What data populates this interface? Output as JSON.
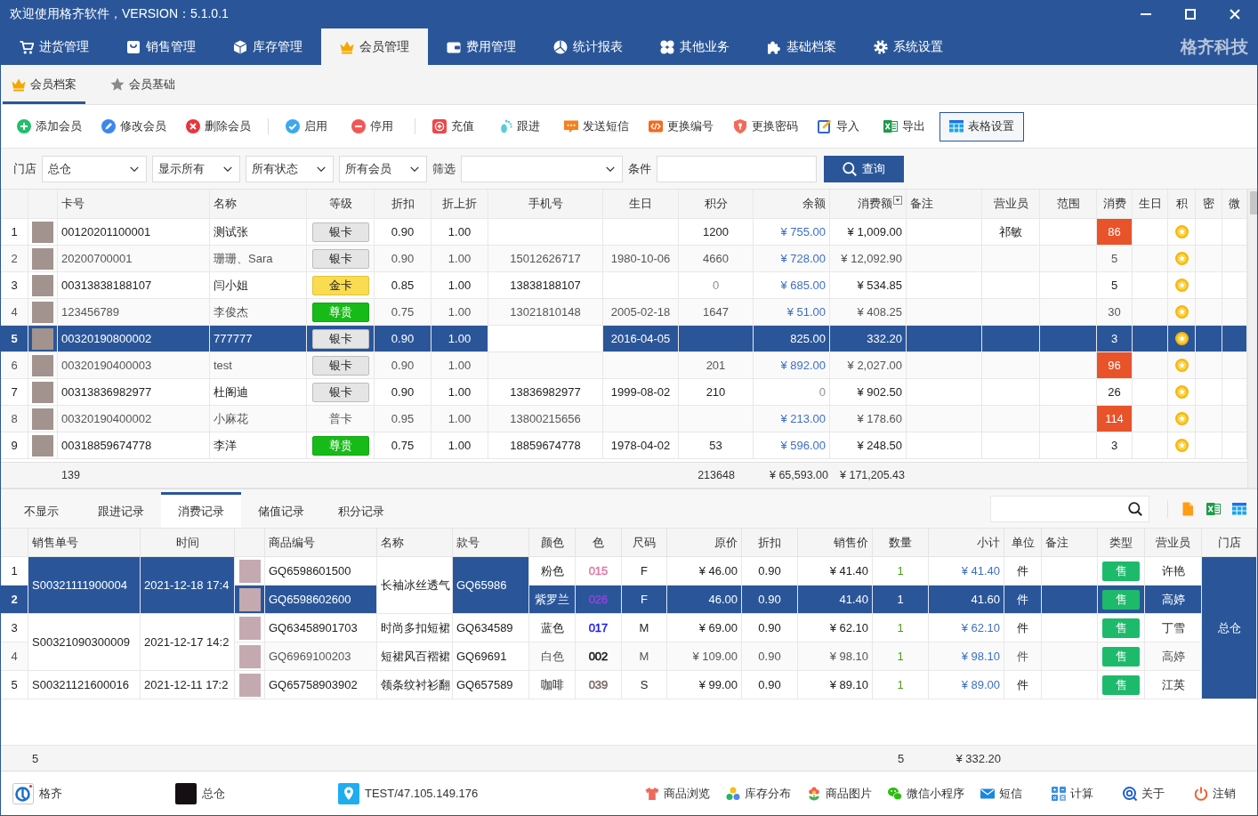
{
  "window": {
    "title": "欢迎使用格齐软件，VERSION：5.1.0.1",
    "brand": "格齐科技"
  },
  "nav_tabs": [
    {
      "label": "进货管理",
      "selected": false
    },
    {
      "label": "销售管理",
      "selected": false
    },
    {
      "label": "库存管理",
      "selected": false
    },
    {
      "label": "会员管理",
      "selected": true
    },
    {
      "label": "费用管理",
      "selected": false
    },
    {
      "label": "统计报表",
      "selected": false
    },
    {
      "label": "其他业务",
      "selected": false
    },
    {
      "label": "基础档案",
      "selected": false
    },
    {
      "label": "系统设置",
      "selected": false
    }
  ],
  "sub_tabs": [
    {
      "label": "会员档案",
      "selected": true
    },
    {
      "label": "会员基础",
      "selected": false
    }
  ],
  "toolbar": [
    [
      {
        "label": "添加会员",
        "active": false
      },
      {
        "label": "修改会员",
        "active": false
      },
      {
        "label": "删除会员",
        "active": false
      }
    ],
    [
      {
        "label": "启用",
        "active": false
      },
      {
        "label": "停用",
        "active": false
      }
    ],
    [
      {
        "label": "充值",
        "active": false
      },
      {
        "label": "跟进",
        "active": false
      },
      {
        "label": "发送短信",
        "active": false
      },
      {
        "label": "更换编号",
        "active": false
      },
      {
        "label": "更换密码",
        "active": false
      },
      {
        "label": "导入",
        "active": false
      },
      {
        "label": "导出",
        "active": false
      },
      {
        "label": "表格设置",
        "active": true
      }
    ]
  ],
  "filter": {
    "store_label": "门店",
    "selects": [
      {
        "value": "总仓"
      },
      {
        "value": "显示所有"
      },
      {
        "value": "所有状态"
      },
      {
        "value": "所有会员"
      }
    ],
    "filter_label": "筛选",
    "condition_label": "条件",
    "query_button": "查询"
  },
  "members": {
    "columns": [
      {
        "label": "卡号",
        "current": false
      },
      {
        "label": "名称",
        "current": false
      },
      {
        "label": "等级",
        "current": false
      },
      {
        "label": "折扣",
        "current": false
      },
      {
        "label": "折上折",
        "current": false
      },
      {
        "label": "手机号",
        "current": true
      },
      {
        "label": "生日",
        "current": false
      },
      {
        "label": "积分",
        "current": false
      },
      {
        "label": "余额",
        "current": false
      },
      {
        "label": "消费额",
        "current": false
      },
      {
        "label": "备注",
        "current": false
      },
      {
        "label": "营业员",
        "current": false
      },
      {
        "label": "范围",
        "current": false
      },
      {
        "label": "消费",
        "current": false
      },
      {
        "label": "生日",
        "current": false
      },
      {
        "label": "积",
        "current": false
      },
      {
        "label": "密",
        "current": false
      },
      {
        "label": "微",
        "current": false
      }
    ],
    "rows": [
      {
        "no": "1",
        "card": "00120201100001",
        "name": "测试张",
        "grade": {
          "text": "银卡",
          "kind": "silver"
        },
        "discount": "0.90",
        "discount2": "1.00",
        "points": "1200",
        "points_muted": false,
        "balance": "¥ 755.00",
        "balance_muted": false,
        "spent": "¥ 1,009.00",
        "clerk": "祁敏",
        "visits": "86",
        "hot": true,
        "selected": false
      },
      {
        "no": "2",
        "card": "20200700001",
        "name": "珊珊、Sara",
        "grade": {
          "text": "银卡",
          "kind": "silver"
        },
        "discount": "0.90",
        "discount2": "1.00",
        "phone": "15012626717",
        "birthday": "1980-10-06",
        "points": "4660",
        "points_muted": false,
        "balance": "¥ 728.00",
        "balance_muted": false,
        "spent": "¥ 12,092.90",
        "visits": "5",
        "hot": false,
        "selected": false
      },
      {
        "no": "3",
        "card": "00313838188107",
        "name": "闫小姐",
        "grade": {
          "text": "金卡",
          "kind": "gold"
        },
        "discount": "0.85",
        "discount2": "1.00",
        "phone": "13838188107",
        "points": "0",
        "points_muted": true,
        "balance": "¥ 685.00",
        "balance_muted": false,
        "spent": "¥ 534.85",
        "visits": "5",
        "hot": false,
        "selected": false
      },
      {
        "no": "4",
        "card": "123456789",
        "name": "李俊杰",
        "grade": {
          "text": "尊贵",
          "kind": "premium"
        },
        "discount": "0.75",
        "discount2": "1.00",
        "phone": "13021810148",
        "birthday": "2005-02-18",
        "points": "1647",
        "points_muted": false,
        "balance": "¥ 51.00",
        "balance_muted": false,
        "spent": "¥ 408.25",
        "visits": "30",
        "hot": false,
        "selected": false
      },
      {
        "no": "5",
        "card": "00320190800002",
        "name": "777777",
        "grade": {
          "text": "银卡",
          "kind": "silver"
        },
        "discount": "0.90",
        "discount2": "1.00",
        "birthday": "2016-04-05",
        "balance": "825.00",
        "balance_muted": false,
        "spent": "332.20",
        "visits": "3",
        "hot": false,
        "selected": true
      },
      {
        "no": "6",
        "card": "00320190400003",
        "name": "test",
        "grade": {
          "text": "银卡",
          "kind": "silver"
        },
        "discount": "0.90",
        "discount2": "1.00",
        "points": "201",
        "points_muted": false,
        "balance": "¥ 892.00",
        "balance_muted": false,
        "spent": "¥ 2,027.00",
        "visits": "96",
        "hot": true,
        "selected": false
      },
      {
        "no": "7",
        "card": "00313836982977",
        "name": "杜阁迪",
        "grade": {
          "text": "银卡",
          "kind": "silver"
        },
        "discount": "0.90",
        "discount2": "1.00",
        "phone": "13836982977",
        "birthday": "1999-08-02",
        "points": "210",
        "points_muted": false,
        "balance": "0",
        "balance_muted": true,
        "spent": "¥ 902.50",
        "visits": "26",
        "hot": false,
        "selected": false
      },
      {
        "no": "8",
        "card": "00320190400002",
        "name": "小麻花",
        "grade": {
          "text": "普卡",
          "kind": "plain"
        },
        "discount": "0.95",
        "discount2": "1.00",
        "phone": "13800215656",
        "balance": "¥ 213.00",
        "balance_muted": false,
        "spent": "¥ 178.60",
        "visits": "114",
        "hot": true,
        "selected": false
      },
      {
        "no": "9",
        "card": "00318859674778",
        "name": "李洋",
        "grade": {
          "text": "尊贵",
          "kind": "premium"
        },
        "discount": "0.75",
        "discount2": "1.00",
        "phone": "18859674778",
        "birthday": "1978-04-02",
        "points": "53",
        "points_muted": false,
        "balance": "¥ 596.00",
        "balance_muted": false,
        "spent": "¥ 248.50",
        "visits": "3",
        "hot": false,
        "selected": false
      }
    ],
    "totals": {
      "count": "139",
      "points": "213648",
      "balance": "¥ 65,593.00",
      "spent": "¥ 171,205.43"
    }
  },
  "record_tabs": [
    {
      "label": "不显示",
      "selected": false
    },
    {
      "label": "跟进记录",
      "selected": false
    },
    {
      "label": "消费记录",
      "selected": true
    },
    {
      "label": "储值记录",
      "selected": false
    },
    {
      "label": "积分记录",
      "selected": false
    }
  ],
  "consumption": {
    "columns": [
      {
        "label": "销售单号",
        "current": false
      },
      {
        "label": "时间",
        "current": false
      },
      {
        "label": "商品编号",
        "current": false
      },
      {
        "label": "名称",
        "current": true
      },
      {
        "label": "款号",
        "current": false
      },
      {
        "label": "颜色",
        "current": false
      },
      {
        "label": "色",
        "current": false
      },
      {
        "label": "尺码",
        "current": false
      },
      {
        "label": "原价",
        "current": false
      },
      {
        "label": "折扣",
        "current": false
      },
      {
        "label": "销售价",
        "current": false
      },
      {
        "label": "数量",
        "current": false
      },
      {
        "label": "小计",
        "current": false
      },
      {
        "label": "单位",
        "current": false
      },
      {
        "label": "备注",
        "current": false
      },
      {
        "label": "类型",
        "current": false
      },
      {
        "label": "营业员",
        "current": false
      },
      {
        "label": "门店",
        "current": false
      }
    ],
    "orders": [
      {
        "sale_no": "S00321111900004",
        "time": "2021-12-18 17:4",
        "styles": [
          {
            "name": "长袖冰丝透气",
            "style_no": "GQ65986",
            "items": [
              {
                "no": "1",
                "code": "GQ6598601500",
                "color_name": "粉色",
                "color_code": "015",
                "color": "#e27aa3",
                "size": "F",
                "price": "¥ 46.00",
                "discount": "0.90",
                "sale_price": "¥ 41.40",
                "qty": "1",
                "subtotal": "¥ 41.40",
                "unit": "件",
                "type": "售",
                "clerk": "许艳",
                "selected": false
              },
              {
                "no": "2",
                "code": "GQ6598602600",
                "color_name": "紫罗兰",
                "color_code": "026",
                "color": "#8e44d8",
                "size": "F",
                "price": "46.00",
                "discount": "0.90",
                "sale_price": "41.40",
                "qty": "1",
                "subtotal": "41.60",
                "unit": "件",
                "type": "售",
                "clerk": "高婷",
                "selected": true
              }
            ]
          }
        ]
      },
      {
        "sale_no": "S00321090300009",
        "time": "2021-12-17 14:2",
        "styles": [
          {
            "name": "时尚多扣短裙",
            "style_no": "GQ634589",
            "items": [
              {
                "no": "3",
                "code": "GQ63458901703",
                "color_name": "蓝色",
                "color_code": "017",
                "color": "#1c1cf0",
                "size": "M",
                "price": "¥ 69.00",
                "discount": "0.90",
                "sale_price": "¥ 62.10",
                "qty": "1",
                "subtotal": "¥ 62.10",
                "unit": "件",
                "type": "售",
                "clerk": "丁雪",
                "selected": false
              }
            ]
          },
          {
            "name": "短裙风百褶裙",
            "style_no": "GQ69691",
            "items": [
              {
                "no": "4",
                "code": "GQ6969100203",
                "color_name": "白色",
                "color_code": "002",
                "color": "#111111",
                "size": "M",
                "price": "¥ 109.00",
                "discount": "0.90",
                "sale_price": "¥ 98.10",
                "qty": "1",
                "subtotal": "¥ 98.10",
                "unit": "件",
                "type": "售",
                "clerk": "高婷",
                "selected": false
              }
            ]
          }
        ]
      },
      {
        "sale_no": "S00321121600016",
        "time": "2021-12-11 17:2",
        "styles": [
          {
            "name": "领条纹衬衫翻",
            "style_no": "GQ657589",
            "items": [
              {
                "no": "5",
                "code": "GQ65758903902",
                "color_name": "咖啡",
                "color_code": "039",
                "color": "#7a6666",
                "size": "S",
                "price": "¥ 99.00",
                "discount": "0.90",
                "sale_price": "¥ 89.10",
                "qty": "1",
                "subtotal": "¥ 89.00",
                "unit": "件",
                "type": "售",
                "clerk": "江英",
                "selected": false
              }
            ]
          }
        ]
      }
    ],
    "store": "总仓",
    "totals": {
      "count": "5",
      "quantity": "5",
      "amount": "¥ 332.20"
    }
  },
  "status_bar": {
    "info": [
      "格齐",
      "总仓",
      "TEST/47.105.149.176"
    ],
    "links": [
      "商品浏览",
      "库存分布",
      "商品图片",
      "微信小程序",
      "短信",
      "计算",
      "关于",
      "注销"
    ]
  }
}
